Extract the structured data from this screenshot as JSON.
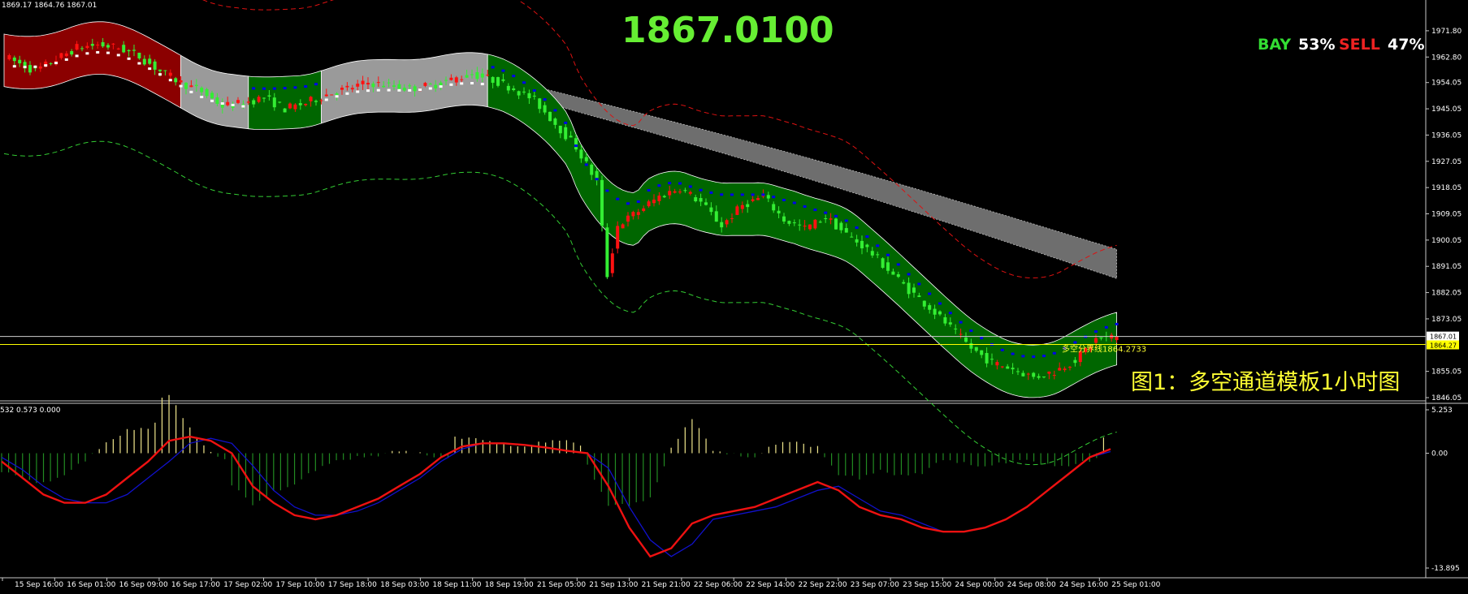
{
  "header": {
    "ohlc_info": "1869.17 1864.76 1867.01",
    "price_display": "1867.0100",
    "bay_label": "BAY",
    "bay_percent": "53%",
    "sell_label": "SELL",
    "sell_percent": "47%",
    "caption": "图1：多空通道模板1小时图"
  },
  "colors": {
    "background": "#000000",
    "price_display": "#66ee33",
    "bay": "#33dd33",
    "sell": "#ee2222",
    "band_bull": "#006600",
    "band_bear": "#8b0000",
    "band_neutral": "#9a9a9a",
    "cloud": "#6e6e6e",
    "trail_dots": "#0000ee",
    "macd_line": "#ee1111",
    "signal_line": "#1111cc",
    "hist_pos": "#f0e68c",
    "hist_neg": "#228b22",
    "level_line": "#ffff00",
    "current_line": "#cccccc"
  },
  "chart_data": [
    {
      "type": "candlestick",
      "timeframe": "1 hour",
      "y_range": [
        1846.05,
        1974.0
      ],
      "y_ticks": [
        "1971.80",
        "1962.80",
        "1954.05",
        "1945.05",
        "1936.05",
        "1927.05",
        "1918.05",
        "1909.05",
        "1900.05",
        "1891.05",
        "1882.05",
        "1873.05",
        "1864.27",
        "1855.05",
        "1846.05"
      ],
      "current_price": 1867.01,
      "current_price_label": "1867.01",
      "level_line": {
        "value": 1864.27,
        "axis_label": "1864.27",
        "text": "多空分界线1864.2733"
      },
      "x_labels": [
        "15 Sep 16:00",
        "16 Sep 01:00",
        "16 Sep 09:00",
        "16 Sep 17:00",
        "17 Sep 02:00",
        "17 Sep 10:00",
        "17 Sep 18:00",
        "18 Sep 03:00",
        "18 Sep 11:00",
        "18 Sep 19:00",
        "21 Sep 05:00",
        "21 Sep 13:00",
        "21 Sep 21:00",
        "22 Sep 06:00",
        "22 Sep 14:00",
        "22 Sep 22:00",
        "23 Sep 07:00",
        "23 Sep 15:00",
        "24 Sep 00:00",
        "24 Sep 08:00",
        "24 Sep 16:00",
        "25 Sep 01:00"
      ],
      "close_path": [
        [
          0,
          1963
        ],
        [
          6,
          1958
        ],
        [
          10,
          1962
        ],
        [
          14,
          1966
        ],
        [
          18,
          1967
        ],
        [
          22,
          1966
        ],
        [
          26,
          1963
        ],
        [
          30,
          1958
        ],
        [
          34,
          1954
        ],
        [
          38,
          1951
        ],
        [
          42,
          1946
        ],
        [
          46,
          1947
        ],
        [
          50,
          1949
        ],
        [
          54,
          1945
        ],
        [
          58,
          1947
        ],
        [
          62,
          1950
        ],
        [
          66,
          1952
        ],
        [
          70,
          1954
        ],
        [
          74,
          1953
        ],
        [
          78,
          1952
        ],
        [
          82,
          1953
        ],
        [
          86,
          1955
        ],
        [
          90,
          1957
        ],
        [
          94,
          1955
        ],
        [
          98,
          1952
        ],
        [
          102,
          1948
        ],
        [
          106,
          1940
        ],
        [
          110,
          1932
        ],
        [
          114,
          1920
        ],
        [
          116,
          1888
        ],
        [
          118,
          1905
        ],
        [
          122,
          1910
        ],
        [
          126,
          1915
        ],
        [
          130,
          1918
        ],
        [
          134,
          1913
        ],
        [
          138,
          1905
        ],
        [
          142,
          1912
        ],
        [
          146,
          1915
        ],
        [
          150,
          1907
        ],
        [
          154,
          1904
        ],
        [
          158,
          1908
        ],
        [
          162,
          1902
        ],
        [
          166,
          1897
        ],
        [
          170,
          1890
        ],
        [
          174,
          1883
        ],
        [
          178,
          1877
        ],
        [
          182,
          1870
        ],
        [
          186,
          1863
        ],
        [
          190,
          1858
        ],
        [
          194,
          1856
        ],
        [
          198,
          1853
        ],
        [
          202,
          1855
        ],
        [
          206,
          1859
        ],
        [
          210,
          1866
        ],
        [
          214,
          1867
        ]
      ],
      "bands": [
        {
          "name": "rising",
          "color": "band_bear",
          "from": 0,
          "to": 34
        },
        {
          "name": "flat",
          "color": "band_neutral",
          "from": 34,
          "to": 47
        },
        {
          "name": "down",
          "color": "band_bull",
          "from": 47,
          "to": 61
        },
        {
          "name": "flat",
          "color": "band_neutral",
          "from": 61,
          "to": 93
        },
        {
          "name": "down",
          "color": "band_bull",
          "from": 93,
          "to": 214
        }
      ]
    },
    {
      "type": "macd",
      "header": "532 0.573 0.000",
      "y_ticks": [
        "5.253",
        "0.00",
        "-13.895"
      ],
      "y_range": [
        -13.895,
        5.253
      ],
      "macd": [
        -1,
        -3,
        -5,
        -6,
        -6,
        -5,
        -3,
        -1,
        1.5,
        2,
        1.5,
        0,
        -4,
        -6,
        -7.5,
        -8,
        -7.5,
        -6.5,
        -5.5,
        -4,
        -2.5,
        -0.5,
        0.8,
        1.2,
        1.2,
        1,
        0.7,
        0.3,
        0,
        -4,
        -9,
        -12.5,
        -11.5,
        -8.5,
        -7.5,
        -7,
        -6.5,
        -5.5,
        -4.5,
        -3.5,
        -4.5,
        -6.5,
        -7.5,
        -8,
        -9,
        -9.5,
        -9.5,
        -9,
        -8,
        -6.5,
        -4.5,
        -2.5,
        -0.5,
        0.5
      ],
      "signal": [
        -0.5,
        -2,
        -4,
        -5.5,
        -6,
        -6,
        -5,
        -3,
        -1,
        1.2,
        1.8,
        1.2,
        -1.5,
        -4.5,
        -6.5,
        -7.5,
        -7.5,
        -7,
        -6,
        -4.5,
        -3,
        -1,
        0.5,
        1.2,
        1.2,
        1,
        0.7,
        0.3,
        0,
        -1.8,
        -6.5,
        -10.5,
        -12.5,
        -11,
        -8,
        -7.5,
        -7,
        -6.5,
        -5.5,
        -4.5,
        -4,
        -5.5,
        -7,
        -7.5,
        -8.5,
        -9.5,
        -9.5,
        -9,
        -8,
        -6.5,
        -4.5,
        -2.5,
        -0.5,
        0.2
      ]
    }
  ]
}
